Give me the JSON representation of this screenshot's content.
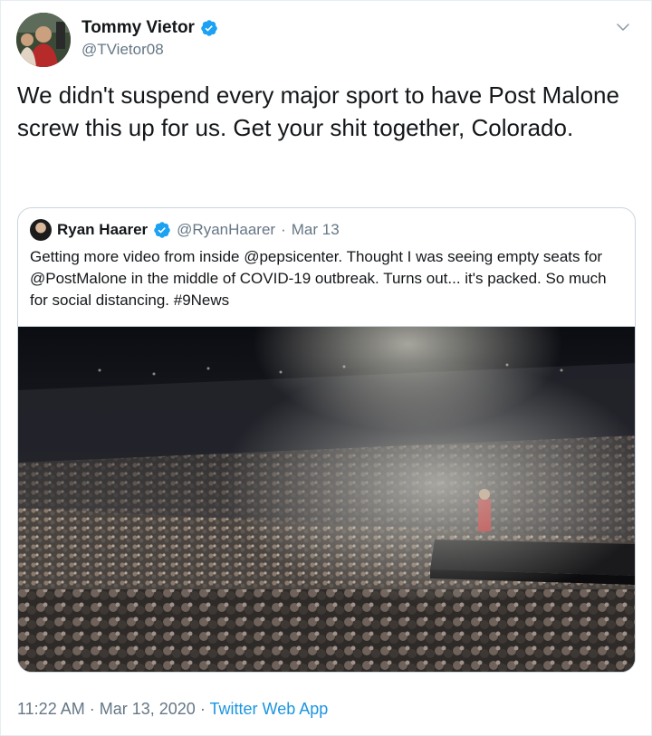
{
  "tweet": {
    "author": {
      "name": "Tommy Vietor",
      "handle": "@TVietor08",
      "verified": true
    },
    "text": "We didn't suspend every major sport to have Post Malone screw this up for us. Get your shit together, Colorado.",
    "quoted_tweet": {
      "author": {
        "name": "Ryan Haarer",
        "handle": "@RyanHaarer",
        "verified": true
      },
      "separator": "·",
      "date": "Mar 13",
      "text": "Getting more video from inside @pepsicenter. Thought I was seeing empty seats for @PostMalone in the middle of COVID-19 outbreak. Turns out... it's packed. So much for social distancing. #9News",
      "media_kind": "video"
    },
    "footer": {
      "time": "11:22 AM",
      "sep1": "·",
      "date": "Mar 13, 2020",
      "sep2": "·",
      "source": "Twitter Web App"
    }
  },
  "icons": {
    "verified": "verified-badge-icon",
    "caret": "chevron-down-icon"
  },
  "colors": {
    "accent": "#1da1f2",
    "link": "#1b95e0",
    "secondary_text": "#657786",
    "border": "#ccd6dd"
  }
}
